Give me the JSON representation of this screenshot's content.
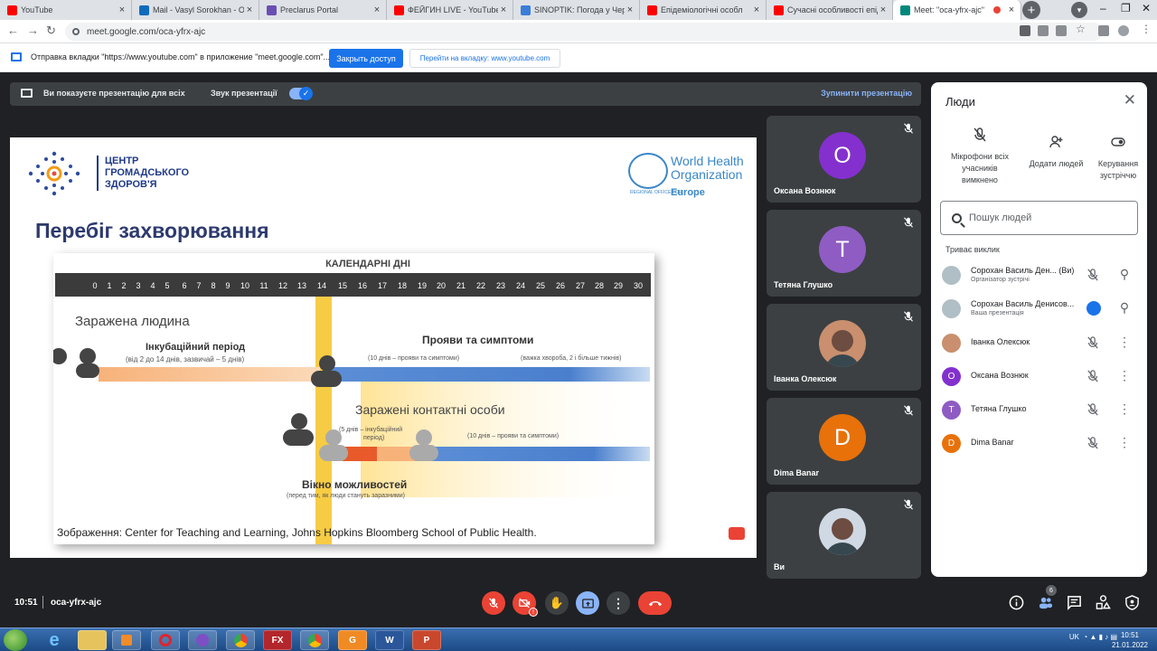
{
  "browser": {
    "tabs": [
      {
        "title": "YouTube",
        "icon": "youtube-icon",
        "color": "#ff0000"
      },
      {
        "title": "Mail - Vasyl Sorokhan - Outl",
        "icon": "outlook-icon",
        "color": "#0f6cbd"
      },
      {
        "title": "Preclarus Portal",
        "icon": "preclarus-icon",
        "color": "#6a4fb3"
      },
      {
        "title": "ФЕЙГИН LIVE - YouTube",
        "icon": "youtube-icon",
        "color": "#ff0000"
      },
      {
        "title": "SINOPTIK: Погода у Черн",
        "icon": "sinoptik-icon",
        "color": "#3b7dd8"
      },
      {
        "title": "Епідеміологічні особл",
        "icon": "youtube-icon",
        "color": "#ff0000"
      },
      {
        "title": "Сучасні особливості епід",
        "icon": "youtube-icon",
        "color": "#ff0000"
      },
      {
        "title": "Meet: \"oca-yfrx-ajc\"",
        "icon": "meet-icon",
        "color": "#00897b",
        "active": true
      }
    ],
    "url": "meet.google.com/oca-yfrx-ajc"
  },
  "infobar": {
    "message": "Отправка вкладки \"https://www.youtube.com\" в приложение \"meet.google.com\"...",
    "stop_button": "Закрыть доступ",
    "switch_button": "Перейти на вкладку: www.youtube.com"
  },
  "presentation_bar": {
    "presenting_text": "Ви показуєте презентацію для всіх",
    "sound_label": "Звук презентації",
    "stop_label": "Зупинити презентацію"
  },
  "slide": {
    "org_name_lines": [
      "ЦЕНТР",
      "ГРОМАДСЬКОГО",
      "ЗДОРОВ'Я"
    ],
    "who_name": [
      "World Health",
      "Organization"
    ],
    "who_region": "Europe",
    "who_small": "REGIONAL OFFICE FOR",
    "title": "Перебіг захворювання",
    "diagram": {
      "header": "КАЛЕНДАРНІ ДНІ",
      "days": [
        "0",
        "1",
        "2",
        "3",
        "4",
        "5",
        "6",
        "7",
        "8",
        "9",
        "10",
        "11",
        "12",
        "13",
        "14",
        "15",
        "16",
        "17",
        "18",
        "19",
        "20",
        "21",
        "22",
        "23",
        "24",
        "25",
        "26",
        "27",
        "28",
        "29",
        "30"
      ],
      "infected_person": "Заражена людина",
      "incubation": "Інкубаційний період",
      "incubation_note": "(від 2 до 14 днів, зазвичай – 5 днів)",
      "symptoms": "Прояви та симптоми",
      "symptoms_note_1": "(10 днів – прояви та симптоми)",
      "symptoms_note_2": "(важка хвороба, 2 і більше тижнів)",
      "contacts": "Заражені контактні особи",
      "contacts_incubation_1": "(5 днів – інкубаційний",
      "contacts_incubation_2": "період)",
      "contacts_symptoms": "(10 днів – прояви та симптоми)",
      "window": "Вікно можливостей",
      "window_note": "(перед тим, як люди стануть заразними)"
    },
    "caption": "Зображення: Center for Teaching and Learning, Johns Hopkins Bloomberg School of Public Health."
  },
  "tiles": [
    {
      "name": "Оксана Вознюк",
      "initial": "O",
      "color": "#8430ce"
    },
    {
      "name": "Тетяна Глушко",
      "initial": "T",
      "color": "#8e5cc3"
    },
    {
      "name": "Іванка Олексюк",
      "initial": "",
      "color": "#c98f6e",
      "photo": true
    },
    {
      "name": "Dima Banar",
      "initial": "D",
      "color": "#e8710a"
    },
    {
      "name": "Ви",
      "initial": "",
      "color": "#cfd8e3",
      "photo": true
    }
  ],
  "people_panel": {
    "title": "Люди",
    "actions": [
      {
        "label": "Мікрофони всіх учасників вимкнено",
        "icon": "mic-off-icon"
      },
      {
        "label": "Додати людей",
        "icon": "add-person-icon"
      },
      {
        "label": "Керування зустріччю",
        "icon": "toggle-icon"
      }
    ],
    "search_placeholder": "Пошук людей",
    "section": "Триває виклик",
    "people": [
      {
        "name": "Сорохан Василь Ден... (Ви)",
        "sub": "Організатор зустрічі",
        "initial": "",
        "color": "#b0bec5"
      },
      {
        "name": "Сорохан Василь Денисов...",
        "sub": "Ваша презентація",
        "initial": "",
        "color": "#b0bec5"
      },
      {
        "name": "Іванка Олексюк",
        "sub": "",
        "initial": "",
        "color": "#c98f6e"
      },
      {
        "name": "Оксана Вознюк",
        "sub": "",
        "initial": "O",
        "color": "#8430ce"
      },
      {
        "name": "Тетяна Глушко",
        "sub": "",
        "initial": "T",
        "color": "#8e5cc3"
      },
      {
        "name": "Dima Banar",
        "sub": "",
        "initial": "D",
        "color": "#e8710a"
      }
    ]
  },
  "bottom_bar": {
    "time": "10:51",
    "meeting_code": "oca-yfrx-ajc",
    "participants_count": "6"
  },
  "taskbar": {
    "lang": "UK",
    "clock_time": "10:51",
    "clock_date": "21.01.2022"
  }
}
